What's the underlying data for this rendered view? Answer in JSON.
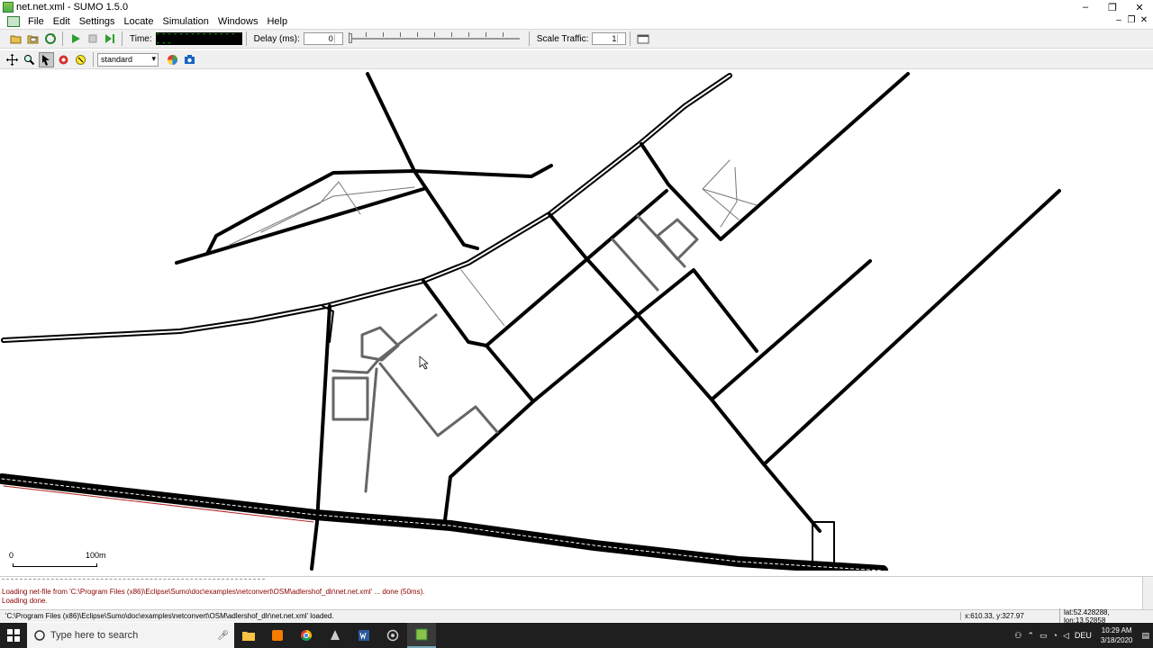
{
  "window": {
    "title": "net.net.xml - SUMO 1.5.0",
    "min": "–",
    "restore": "❐",
    "close": "✕"
  },
  "menu": {
    "items": [
      "File",
      "Edit",
      "Settings",
      "Locate",
      "Simulation",
      "Windows",
      "Help"
    ]
  },
  "toolbar": {
    "time_label": "Time:",
    "time_value": "-----------------",
    "delay_label": "Delay (ms):",
    "delay_value": "0",
    "scale_label": "Scale Traffic:",
    "scale_value": "1"
  },
  "view_toolbar": {
    "scheme": "standard"
  },
  "scale": {
    "zero": "0",
    "hundred": "100m"
  },
  "log": {
    "line1": "Loading net-file from 'C:\\Program Files (x86)\\Eclipse\\Sumo\\doc\\examples\\netconvert\\OSM\\adlershof_dlr\\net.net.xml' ... done (50ms).",
    "line2": "Loading done."
  },
  "status": {
    "message": "'C:\\Program Files (x86)\\Eclipse\\Sumo\\doc\\examples\\netconvert\\OSM\\adlershof_dlr\\net.net.xml' loaded.",
    "coords": "x:610.33, y:327.97",
    "geo": "lat:52.428288, lon:13.52858"
  },
  "taskbar": {
    "search_placeholder": "Type here to search",
    "time": "10:29 AM",
    "date": "3/18/2020",
    "lang": "DEU"
  },
  "colors": {
    "road": "#000000",
    "minor_road": "#808080",
    "rail": "#b22222"
  }
}
